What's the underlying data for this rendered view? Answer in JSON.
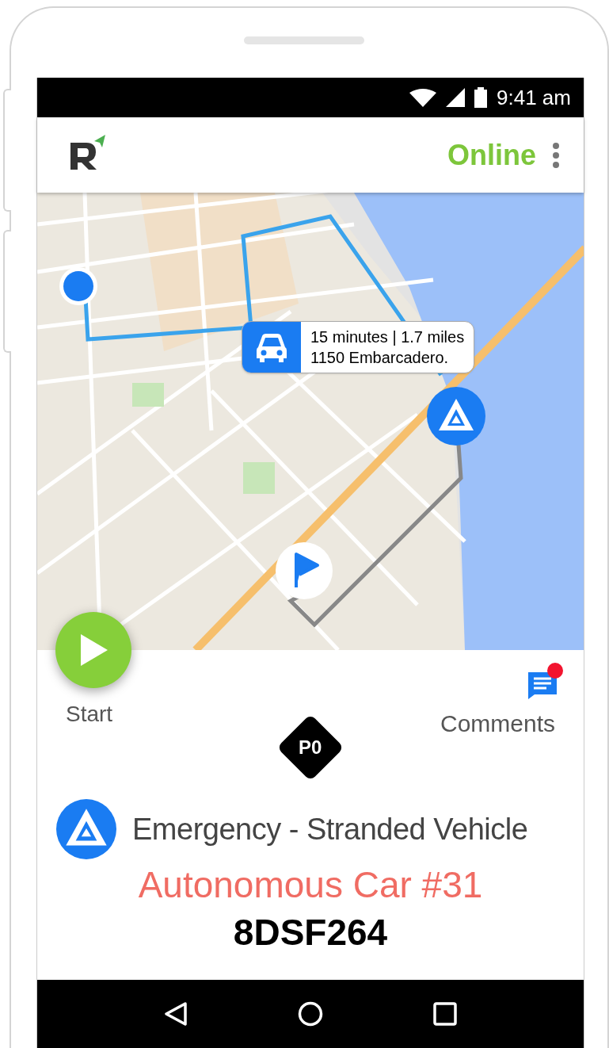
{
  "status_bar": {
    "time": "9:41 am"
  },
  "app_bar": {
    "status": "Online"
  },
  "map": {
    "eta_callout": {
      "line_1": "15 minutes | 1.7 miles",
      "line_2": "1150 Embarcadero."
    }
  },
  "actions": {
    "start": "Start",
    "comments": {
      "label": "Comments",
      "unread": true
    }
  },
  "incident": {
    "priority": "P0",
    "type": "Emergency - Stranded Vehicle",
    "vehicle": "Autonomous Car #31",
    "plate": "8DSF264"
  }
}
